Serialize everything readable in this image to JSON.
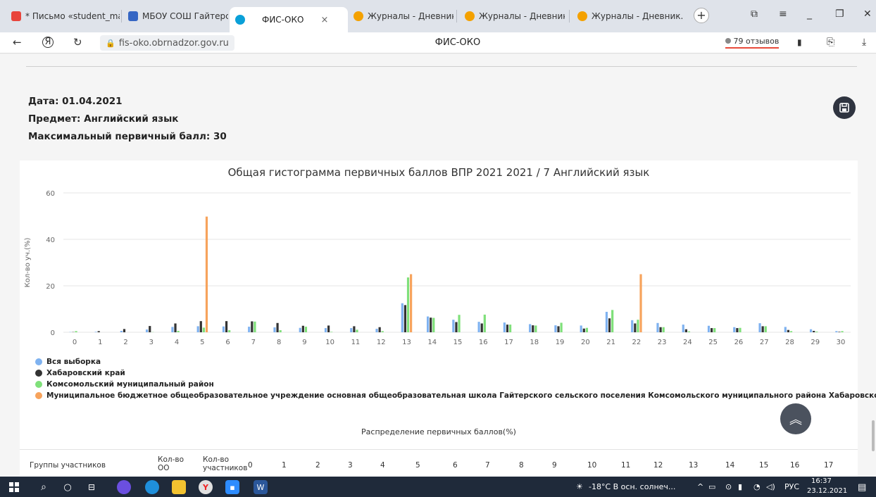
{
  "browser": {
    "tabs": [
      {
        "label": "* Письмо «student_ma",
        "color": "#e8453c"
      },
      {
        "label": "МБОУ СОШ Гайтерско",
        "color": "#3566c4"
      },
      {
        "label": "ФИС-ОКО",
        "color": "#0aa0d8",
        "close": "×"
      },
      {
        "label": "Журналы - Дневник.р",
        "color": "#f4a100"
      },
      {
        "label": "Журналы - Дневник.р",
        "color": "#f4a100"
      },
      {
        "label": "Журналы - Дневник.р",
        "color": "#f4a100"
      }
    ],
    "new_tab": "+",
    "url": "fis-oko.obrnadzor.gov.ru",
    "page_title": "ФИС-ОКО",
    "reviews": "79 отзывов"
  },
  "report": {
    "date_line": "Дата: 01.04.2021",
    "subject_line": "Предмет: Английский язык",
    "max_line": "Максимальный первичный балл: 30"
  },
  "chart_data": {
    "type": "bar",
    "title": "Общая гистограмма первичных баллов ВПР 2021 2021 / 7 Английский язык",
    "ylabel": "Кол-во уч.(%)",
    "xlabel": "",
    "ylim": [
      0,
      60
    ],
    "yticks": [
      0,
      20,
      40,
      60
    ],
    "categories": [
      "0",
      "1",
      "2",
      "3",
      "4",
      "5",
      "6",
      "7",
      "8",
      "9",
      "10",
      "11",
      "12",
      "13",
      "14",
      "15",
      "16",
      "17",
      "18",
      "19",
      "20",
      "21",
      "22",
      "23",
      "24",
      "25",
      "26",
      "27",
      "28",
      "29",
      "30"
    ],
    "series": [
      {
        "name": "Вся выборка",
        "color": "#7fb2f0",
        "values": [
          0.1,
          0.2,
          0.6,
          1.2,
          2.3,
          2.6,
          2.5,
          2.4,
          2.1,
          1.9,
          1.8,
          1.8,
          1.5,
          12.5,
          6.8,
          5.4,
          4.5,
          4.2,
          3.5,
          3.0,
          2.9,
          8.8,
          5.2,
          4.0,
          3.3,
          2.8,
          2.2,
          3.9,
          2.3,
          1.3,
          0.5
        ]
      },
      {
        "name": "Хабаровский край",
        "color": "#333333",
        "values": [
          0.1,
          0.5,
          1.4,
          2.7,
          3.8,
          4.8,
          4.8,
          4.7,
          4.0,
          2.8,
          2.9,
          2.6,
          2.2,
          11.7,
          6.3,
          4.4,
          3.8,
          3.3,
          3.0,
          2.6,
          1.6,
          6.0,
          3.8,
          2.2,
          1.3,
          1.8,
          1.8,
          2.6,
          1.0,
          0.6,
          0.2
        ]
      },
      {
        "name": "Комсомольский муниципальный район",
        "color": "#7fe07a",
        "values": [
          0.5,
          0,
          0,
          0.1,
          0.6,
          2.0,
          0.9,
          4.6,
          0.9,
          2.4,
          0.2,
          1.1,
          0.5,
          23.6,
          6.2,
          7.5,
          7.6,
          3.3,
          2.9,
          4.1,
          1.9,
          9.6,
          5.4,
          2.2,
          0.4,
          1.8,
          1.9,
          2.6,
          0.5,
          0.3,
          0.5
        ]
      },
      {
        "name": "Муниципальное бюджетное общеобразовательное учреждение основная общеобразовательная школа Гайтерского сельского поселения Комсомольского муниципального района Хабаровского кр...",
        "color": "#f7a35c",
        "values": [
          0,
          0,
          0,
          0,
          0,
          49.8,
          0,
          0,
          0,
          0,
          0,
          0,
          0,
          25.0,
          0,
          0,
          0,
          0,
          0,
          0,
          0,
          0,
          25.0,
          0,
          0,
          0,
          0,
          0,
          0,
          0,
          0
        ]
      }
    ],
    "legend_position": "bottom-left",
    "grid": true,
    "x_title": "Распределение первичных баллов(%)"
  },
  "table_header": {
    "col_groups": "Группы участников",
    "col_oo": "Кол-во ОО",
    "col_participants": "Кол-во участников",
    "scores": [
      "0",
      "1",
      "2",
      "3",
      "4",
      "5",
      "6",
      "7",
      "8",
      "9",
      "10",
      "11",
      "12",
      "13",
      "14",
      "15",
      "16",
      "17"
    ]
  },
  "taskbar": {
    "weather": "-18°C  В осн. солнеч...",
    "lang": "РУС",
    "time": "16:37",
    "date": "23.12.2021"
  }
}
